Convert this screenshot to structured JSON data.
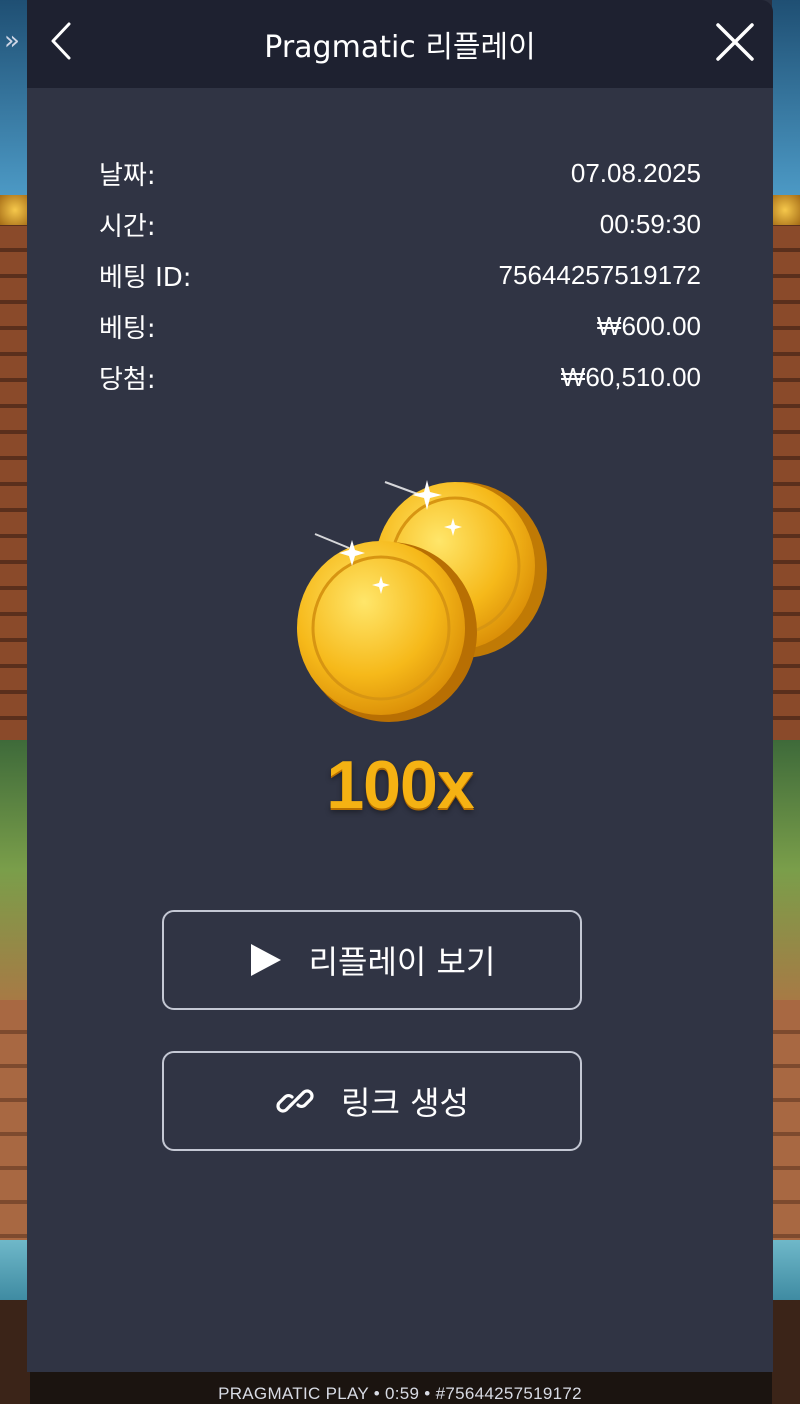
{
  "header": {
    "title": "Pragmatic 리플레이",
    "back_icon": "chevron-left-icon",
    "close_icon": "close-icon"
  },
  "side_toggle_icon": "double-chevron-right-icon",
  "details": [
    {
      "label": "날짜:",
      "value": "07.08.2025"
    },
    {
      "label": "시간:",
      "value": "00:59:30"
    },
    {
      "label": "베팅 ID:",
      "value": "75644257519172"
    },
    {
      "label": "베팅:",
      "value": "₩600.00"
    },
    {
      "label": "당첨:",
      "value": "₩60,510.00"
    }
  ],
  "win": {
    "multiplier": "100x",
    "icon": "gold-coins-icon"
  },
  "actions": {
    "replay_label": "리플레이 보기",
    "replay_icon": "play-icon",
    "link_label": "링크 생성",
    "link_icon": "link-icon"
  },
  "footer_ticker": "PRAGMATIC PLAY • 0:59 • #75644257519172",
  "colors": {
    "panel": "#303444",
    "header": "#1e2130",
    "accent_gold": "#f5b213"
  }
}
